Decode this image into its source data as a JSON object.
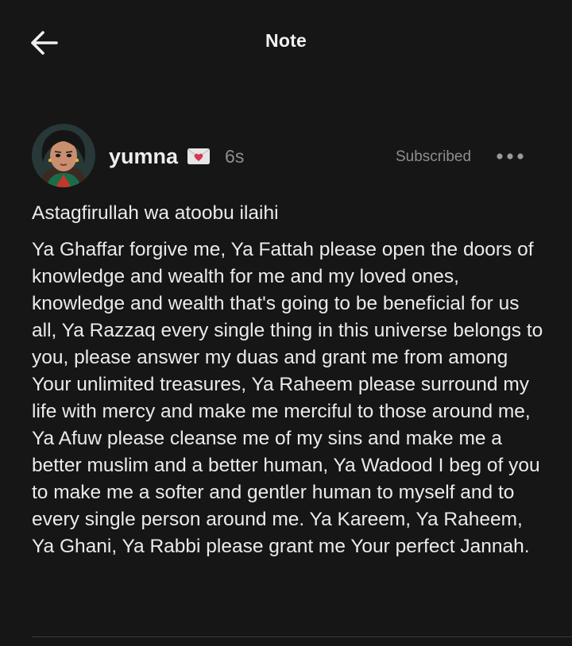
{
  "header": {
    "title": "Note",
    "back_icon": "arrow-left-icon"
  },
  "note": {
    "author": {
      "name": "yumna",
      "badge_icon": "envelope-heart-icon",
      "avatar_icon": "avatar-illustration"
    },
    "timestamp": "6s",
    "subscription_status": "Subscribed",
    "more_icon": "more-horizontal-icon",
    "paragraphs": [
      "Astagfirullah wa atoobu ilaihi",
      "Ya Ghaffar forgive me, Ya Fattah please open the doors of knowledge and wealth for me and my loved ones, knowledge and wealth that's going to be beneficial for us all, Ya Razzaq every single thing in this universe belongs to you, please answer my duas and grant me from among Your unlimited treasures, Ya Raheem please surround my life with mercy and make me merciful to those around me, Ya Afuw please cleanse me of my sins and make me a better muslim and a better human, Ya Wadood I beg of you to make me a softer and gentler human to myself and to every single person around me. Ya Kareem, Ya Raheem, Ya Ghani, Ya Rabbi please grant me Your perfect Jannah."
    ]
  },
  "colors": {
    "background": "#161616",
    "text_primary": "#ebebeb",
    "text_muted": "#8e8e8e",
    "badge_heart": "#d5384f"
  }
}
